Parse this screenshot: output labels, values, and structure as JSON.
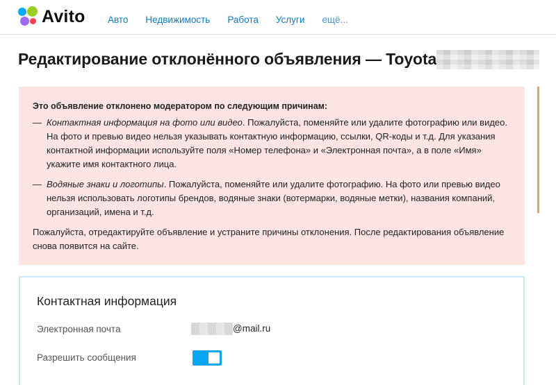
{
  "header": {
    "logo_text": "Avito",
    "nav": [
      "Авто",
      "Недвижимость",
      "Работа",
      "Услуги",
      "ещё..."
    ]
  },
  "page": {
    "title": "Редактирование отклонённого объявления — Toyota"
  },
  "alert": {
    "heading": "Это объявление отклонено модератором по следующим причинам:",
    "reasons": [
      {
        "dash": "—",
        "title": "Контактная информация на фото или видео",
        "text": ". Пожалуйста, поменяйте или удалите фотографию или видео. На фото и превью видео нельзя указывать контактную информацию, ссылки, QR-коды и т.д. Для указания контактной информации используйте поля «Номер телефона» и «Электронная почта», а в поле «Имя» укажите имя контактного лица."
      },
      {
        "dash": "—",
        "title": "Водяные знаки и логотипы",
        "text": ". Пожалуйста, поменяйте или удалите фотографию. На фото или превью видео нельзя использовать логотипы брендов, водяные знаки (вотермарки, водяные метки), названия компаний, организаций, имена и т.д."
      }
    ],
    "footer": "Пожалуйста, отредактируйте объявление и устраните причины отклонения. После редактирования объявление снова появится на сайте."
  },
  "contact": {
    "title": "Контактная информация",
    "email_label": "Электронная почта",
    "email_domain": "@mail.ru",
    "messages_label": "Разрешить сообщения",
    "messages_enabled": true
  },
  "colors": {
    "link": "#0a7bc8",
    "alert_bg": "#fce3e4",
    "toggle_on": "#0aa6f5",
    "side_accent": "#f4a340"
  }
}
